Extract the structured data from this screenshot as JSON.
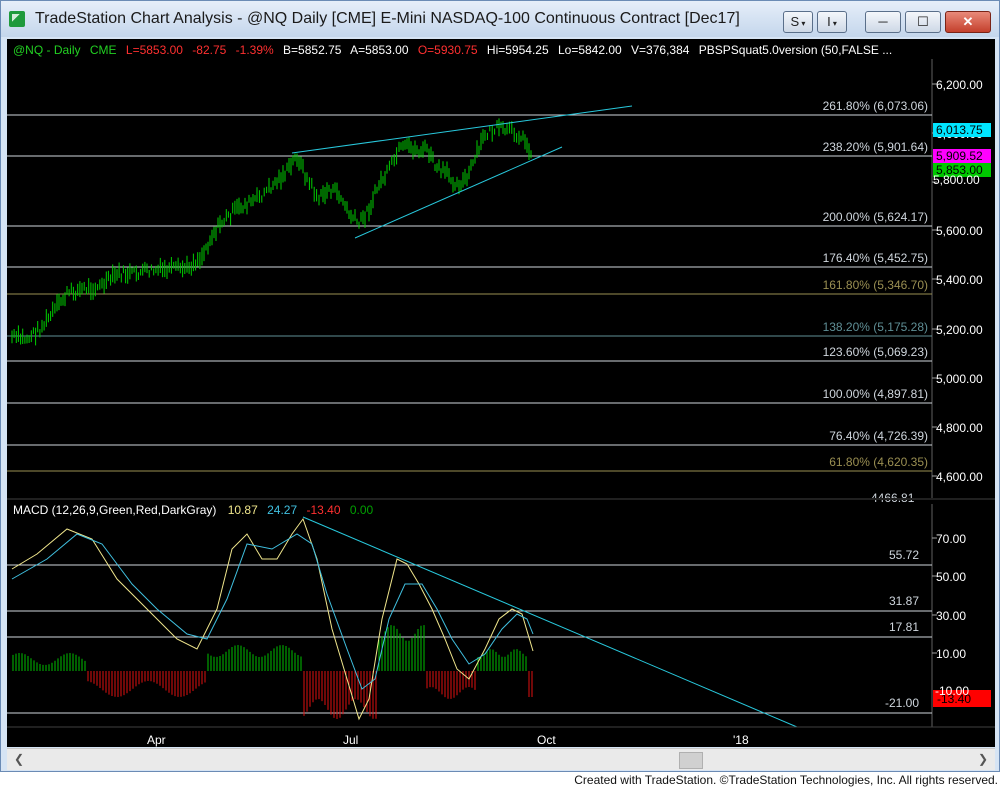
{
  "window": {
    "title": "TradeStation Chart Analysis - @NQ Daily [CME] E-Mini NASDAQ-100 Continuous Contract [Dec17]",
    "buttons": {
      "s_label": "S",
      "i_label": "I",
      "minimize": "─",
      "maximize": "☐",
      "close": "✕"
    }
  },
  "price_panel": {
    "header": {
      "symbol": "@NQ - Daily",
      "exchange": "CME",
      "last": "L=5853.00",
      "change": "-82.75",
      "pct_change": "-1.39%",
      "bid": "B=5852.75",
      "ask": "A=5853.00",
      "open": "O=5930.75",
      "high": "Hi=5954.25",
      "low": "Lo=5842.00",
      "volume": "V=376,384",
      "study": "PBSPSquat5.0version (50,FALSE ..."
    },
    "y_ticks": [
      "6,200.00",
      "6,000.00",
      "5,800.00",
      "5,600.00",
      "5,400.00",
      "5,200.00",
      "5,000.00",
      "4,800.00",
      "4,600.00"
    ],
    "fib_levels": [
      {
        "label": "261.80% (6,073.06)",
        "color": "#cfd6dd"
      },
      {
        "label": "238.20% (5,901.64)",
        "color": "#cfd6dd"
      },
      {
        "label": "200.00% (5,624.17)",
        "color": "#cfd6dd"
      },
      {
        "label": "176.40% (5,452.75)",
        "color": "#cfd6dd"
      },
      {
        "label": "161.80% (5,346.70)",
        "color": "#9a8f52"
      },
      {
        "label": "138.20% (5,175.28)",
        "color": "#5f8f96"
      },
      {
        "label": "123.60% (5,069.23)",
        "color": "#cfd6dd"
      },
      {
        "label": "100.00% (4,897.81)",
        "color": "#cfd6dd"
      },
      {
        "label": "76.40% (4,726.39)",
        "color": "#cfd6dd"
      },
      {
        "label": "61.80% (4,620.35)",
        "color": "#9a8f52"
      }
    ],
    "partial_level_label": "4466.81",
    "price_tags": [
      {
        "label": "6,013.75",
        "bg": "#00e5ff",
        "fg": "#000000"
      },
      {
        "label": "5,909.52",
        "bg": "#ff00ff",
        "fg": "#000000"
      },
      {
        "label": "5,853.00",
        "bg": "#00c800",
        "fg": "#000000"
      }
    ],
    "partial_tick": "5,800.00"
  },
  "macd_panel": {
    "header": {
      "name": "MACD (12,26,9,Green,Red,DarkGray)",
      "macd": "10.87",
      "signal": "24.27",
      "hist": "-13.40",
      "zero": "0.00"
    },
    "y_ticks": [
      "70.00",
      "50.00",
      "30.00",
      "10.00"
    ],
    "partial_tick": "-10.00",
    "levels": [
      "55.72",
      "31.87",
      "17.81",
      "-21.00"
    ],
    "tag": {
      "label": "-13.40",
      "bg": "#ff0000",
      "fg": "#000000"
    }
  },
  "x_axis": {
    "labels": [
      "Apr",
      "Jul",
      "Oct",
      "'18"
    ]
  },
  "footer": "Created with TradeStation. ©TradeStation Technologies, Inc. All rights reserved.",
  "colors": {
    "background": "#000000",
    "up_bar": "#00d000",
    "trendline": "#28c8dc",
    "macd_line": "#f0e68c",
    "signal_line": "#40c0e0",
    "hist_pos": "#00c000",
    "hist_neg": "#e01010"
  }
}
